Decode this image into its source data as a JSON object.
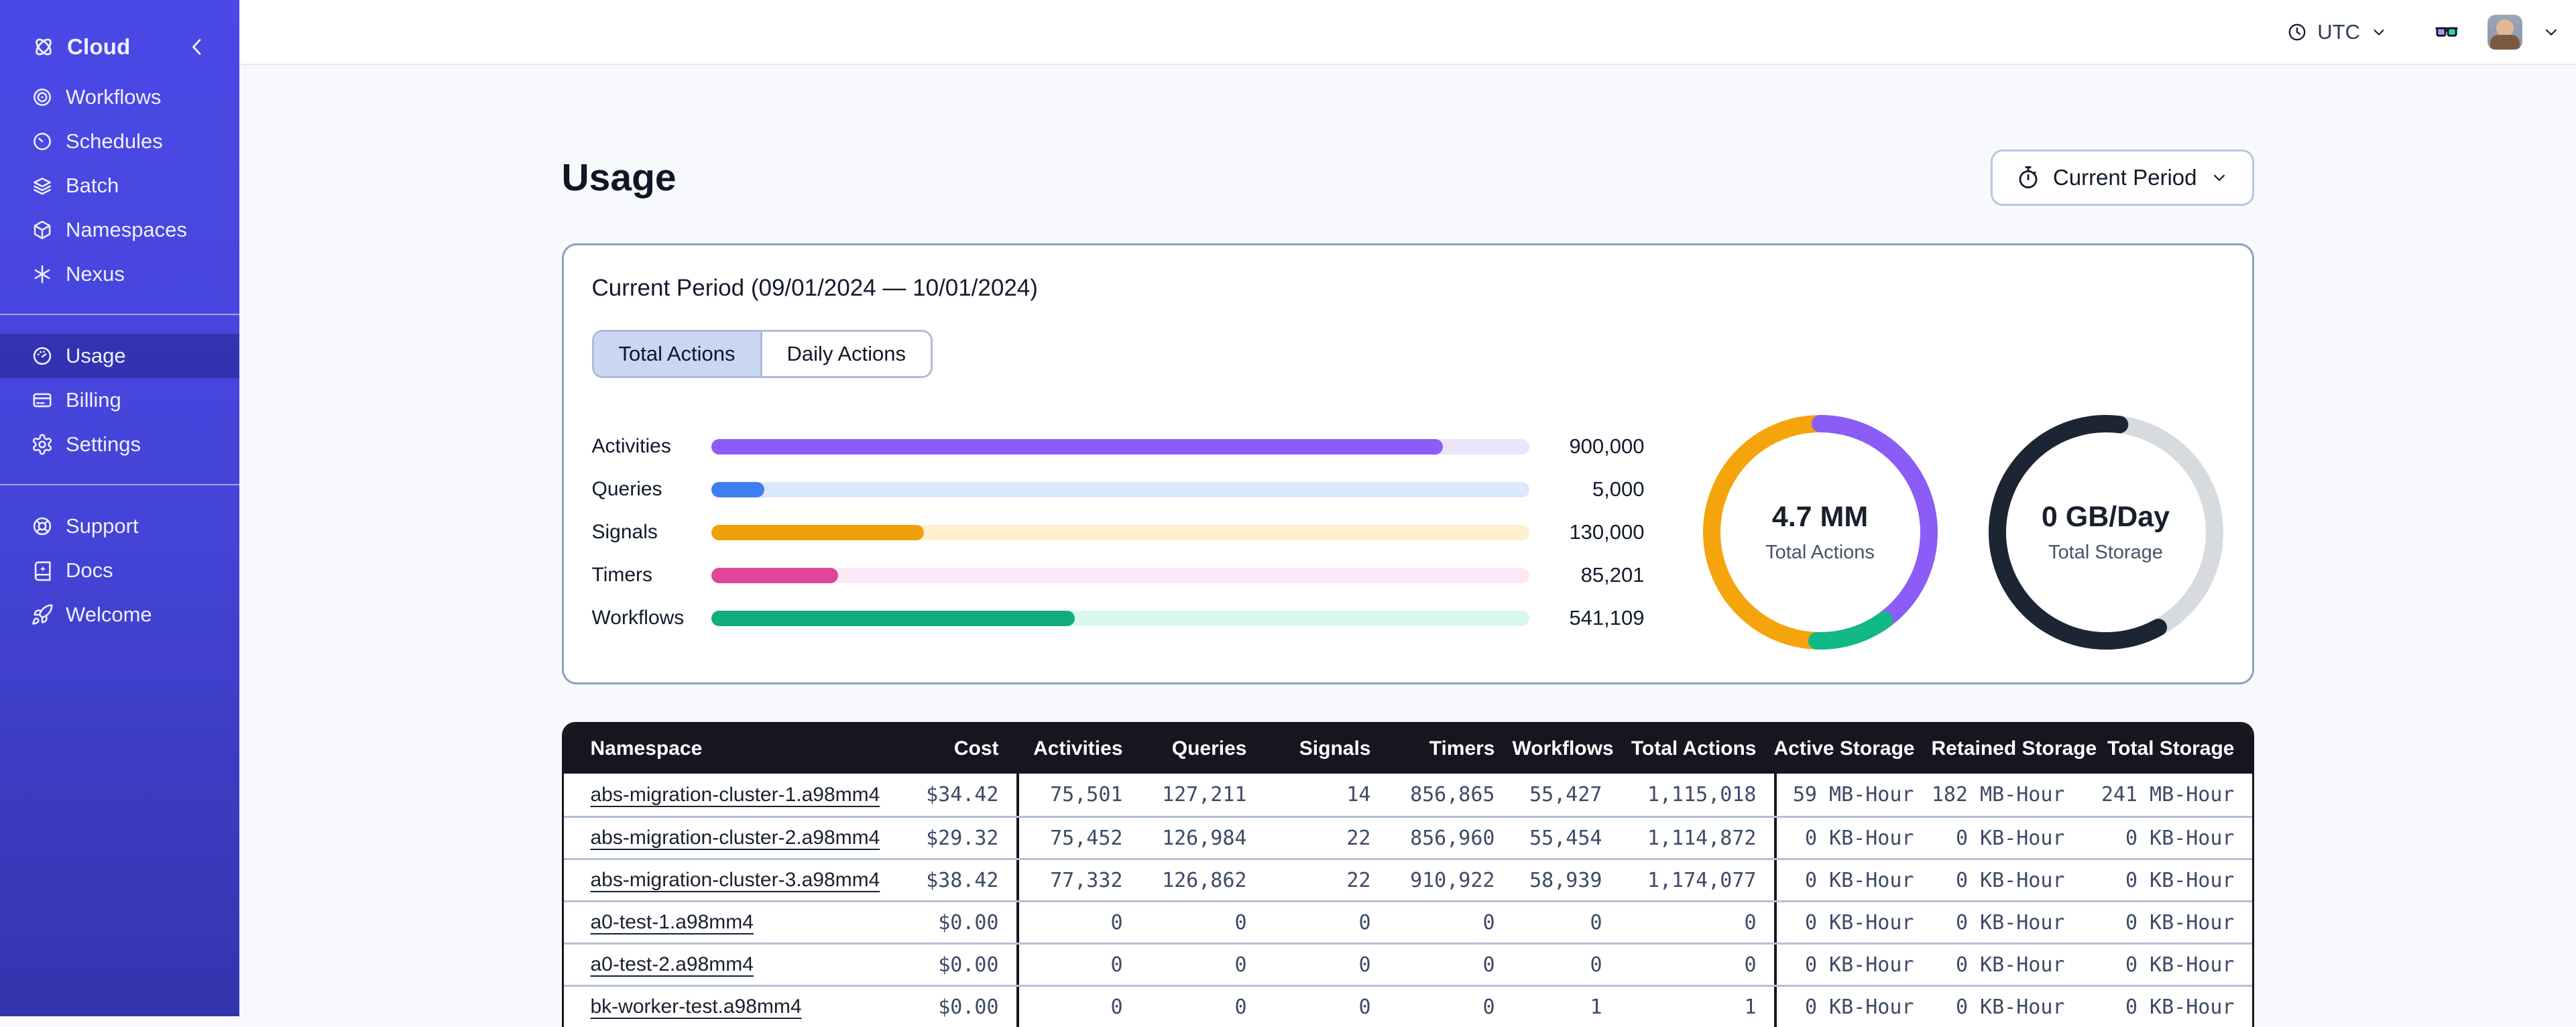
{
  "theme": {
    "sidebar_color": "#4645dd",
    "accent": "#4645dd",
    "background": "#f7f9fc",
    "card_border": "#8fa0bd",
    "table_header_bg": "#15161f"
  },
  "sidebar": {
    "brand": {
      "label": "Cloud",
      "icon": "temporal-logo-icon"
    },
    "nav_main": [
      {
        "label": "Workflows",
        "icon": "workflows-icon"
      },
      {
        "label": "Schedules",
        "icon": "schedules-icon"
      },
      {
        "label": "Batch",
        "icon": "batch-icon"
      },
      {
        "label": "Namespaces",
        "icon": "namespaces-icon"
      },
      {
        "label": "Nexus",
        "icon": "nexus-icon"
      }
    ],
    "nav_account": [
      {
        "label": "Usage",
        "icon": "usage-icon",
        "active": true
      },
      {
        "label": "Billing",
        "icon": "billing-icon"
      },
      {
        "label": "Settings",
        "icon": "settings-icon"
      }
    ],
    "nav_footer": [
      {
        "label": "Support",
        "icon": "support-icon"
      },
      {
        "label": "Docs",
        "icon": "docs-icon"
      },
      {
        "label": "Welcome",
        "icon": "welcome-icon"
      }
    ]
  },
  "topbar": {
    "timezone": {
      "label": "UTC",
      "icon": "clock-icon"
    },
    "glasses_icon": "glasses-icon",
    "avatar": "user-avatar"
  },
  "page": {
    "title": "Usage",
    "period_button": {
      "label": "Current Period",
      "icon": "stopwatch-icon"
    }
  },
  "card": {
    "title": "Current Period (09/01/2024 — 10/01/2024)",
    "tabs": [
      {
        "label": "Total Actions",
        "active": true
      },
      {
        "label": "Daily Actions",
        "active": false
      }
    ]
  },
  "chart_data": [
    {
      "type": "bar",
      "name": "actions-by-type",
      "orientation": "horizontal",
      "categories": [
        "Activities",
        "Queries",
        "Signals",
        "Timers",
        "Workflows"
      ],
      "values": [
        900000,
        5000,
        130000,
        85201,
        541109
      ],
      "value_labels": [
        "900,000",
        "5,000",
        "130,000",
        "85,201",
        "541,109"
      ],
      "bar_fractions": [
        0.895,
        0.065,
        0.26,
        0.155,
        0.445
      ],
      "colors": [
        "#8b5cf6",
        "#3f7df4",
        "#f0a009",
        "#e0459a",
        "#12ad7e"
      ],
      "track_colors": [
        "#ebe4fb",
        "#dce8fb",
        "#fcf0cf",
        "#fce8f7",
        "#d9f8ec"
      ],
      "grid": false
    },
    {
      "type": "donut",
      "name": "total-actions-donut",
      "center_value": "4.7 MM",
      "center_label": "Total Actions",
      "base_color": null,
      "segments": [
        {
          "label": "Signals",
          "color": "#f5a40b",
          "start": 0.505,
          "end": 1.0,
          "fraction": 0.495
        },
        {
          "label": "Activities",
          "color": "#8b5cf6",
          "start": 0.0,
          "end": 0.4,
          "fraction": 0.4
        },
        {
          "label": "Workflows",
          "color": "#12b886",
          "start": 0.4,
          "end": 0.505,
          "fraction": 0.105
        }
      ]
    },
    {
      "type": "donut",
      "name": "total-storage-donut",
      "center_value": "0 GB/Day",
      "center_label": "Total Storage",
      "base_color": "#d7dade",
      "segments": [
        {
          "label": "Storage",
          "color": "#1c2533",
          "start": 0.42,
          "end": 1.02,
          "fraction": 0.6
        }
      ]
    }
  ],
  "table": {
    "columns": [
      {
        "label": "Namespace",
        "align": "left"
      },
      {
        "label": "Cost",
        "align": "right"
      },
      {
        "label": "Activities",
        "align": "right",
        "group_start": true
      },
      {
        "label": "Queries",
        "align": "right"
      },
      {
        "label": "Signals",
        "align": "right"
      },
      {
        "label": "Timers",
        "align": "right"
      },
      {
        "label": "Workflows",
        "align": "right"
      },
      {
        "label": "Total Actions",
        "align": "right"
      },
      {
        "label": "Active Storage",
        "align": "right",
        "group_start": true
      },
      {
        "label": "Retained Storage",
        "align": "right"
      },
      {
        "label": "Total Storage",
        "align": "right"
      }
    ],
    "rows": [
      [
        "abs-migration-cluster-1.a98mm4",
        "$34.42",
        "75,501",
        "127,211",
        "14",
        "856,865",
        "55,427",
        "1,115,018",
        "59 MB-Hour",
        "182 MB-Hour",
        "241 MB-Hour"
      ],
      [
        "abs-migration-cluster-2.a98mm4",
        "$29.32",
        "75,452",
        "126,984",
        "22",
        "856,960",
        "55,454",
        "1,114,872",
        "0 KB-Hour",
        "0 KB-Hour",
        "0 KB-Hour"
      ],
      [
        "abs-migration-cluster-3.a98mm4",
        "$38.42",
        "77,332",
        "126,862",
        "22",
        "910,922",
        "58,939",
        "1,174,077",
        "0 KB-Hour",
        "0 KB-Hour",
        "0 KB-Hour"
      ],
      [
        "a0-test-1.a98mm4",
        "$0.00",
        "0",
        "0",
        "0",
        "0",
        "0",
        "0",
        "0 KB-Hour",
        "0 KB-Hour",
        "0 KB-Hour"
      ],
      [
        "a0-test-2.a98mm4",
        "$0.00",
        "0",
        "0",
        "0",
        "0",
        "0",
        "0",
        "0 KB-Hour",
        "0 KB-Hour",
        "0 KB-Hour"
      ],
      [
        "bk-worker-test.a98mm4",
        "$0.00",
        "0",
        "0",
        "0",
        "0",
        "1",
        "1",
        "0 KB-Hour",
        "0 KB-Hour",
        "0 KB-Hour"
      ]
    ]
  }
}
